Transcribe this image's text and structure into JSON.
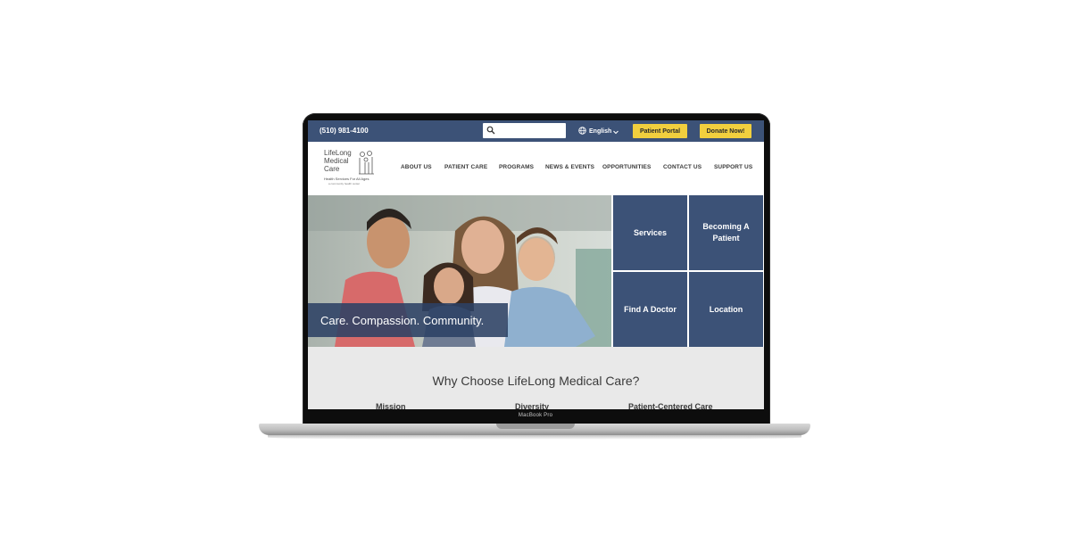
{
  "device_label": "MacBook Pro",
  "topbar": {
    "phone": "(510) 981-4100",
    "search_placeholder": "",
    "language": "English",
    "patient_portal": "Patient Portal",
    "donate": "Donate Now!"
  },
  "logo": {
    "line1": "LifeLong",
    "line2": "Medical",
    "line3": "Care",
    "tagline": "Health Services For All Ages",
    "subline": "a community health center"
  },
  "nav": [
    "ABOUT US",
    "PATIENT CARE",
    "PROGRAMS",
    "NEWS & EVENTS",
    "OPPORTUNITIES",
    "CONTACT US",
    "SUPPORT US"
  ],
  "hero": {
    "tagline": "Care. Compassion. Community."
  },
  "tiles": [
    "Services",
    "Becoming A Patient",
    "Find A Doctor",
    "Location"
  ],
  "why": {
    "title": "Why Choose LifeLong Medical Care?",
    "columns": [
      "Mission",
      "Diversity",
      "Patient-Centered Care"
    ]
  },
  "colors": {
    "navy": "#3c5277",
    "yellow": "#f1cf3e",
    "section_bg": "#e9e9e9"
  }
}
